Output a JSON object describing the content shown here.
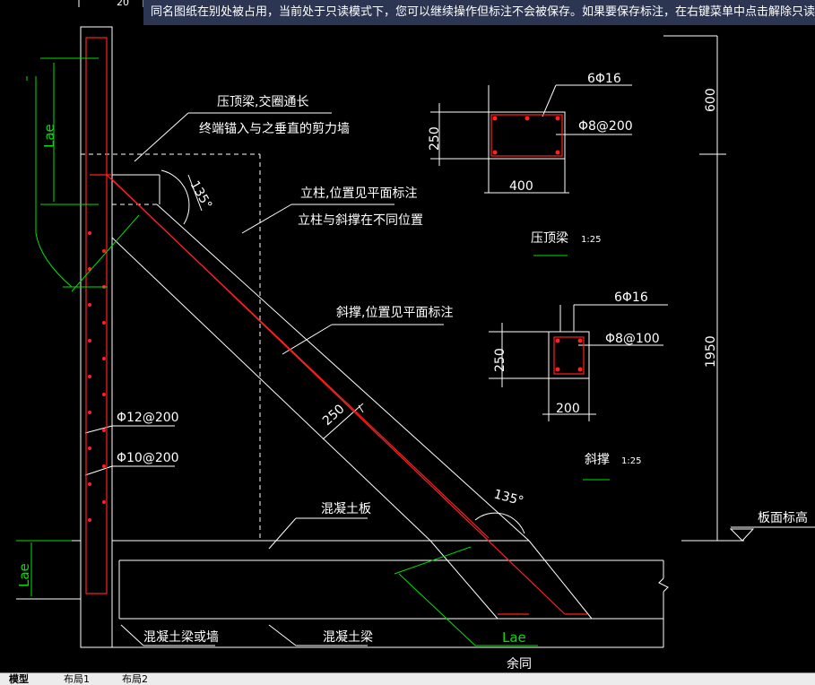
{
  "notice": "同名图纸在别处被占用，当前处于只读模式下，您可以继续操作但标注不会被保存。如果要保存标注，在右键菜单中点击解除只读锁",
  "labels": {
    "lae_top": "Lae",
    "lae_bottom": "Lae",
    "lae_right": "Lae",
    "note_beam_1": "压顶梁,交圈通长",
    "note_beam_2": "终端锚入与之垂直的剪力墙",
    "note_column_1": "立柱,位置见平面标注",
    "note_column_2": "立柱与斜撑在不同位置",
    "note_brace": "斜撑,位置见平面标注",
    "angle_top": "135°",
    "angle_bottom": "135°",
    "brace_width": "250",
    "rebar_1": "Φ12@200",
    "rebar_2": "Φ10@200",
    "slab": "混凝土板",
    "beam_wall": "混凝土梁或墙",
    "beam": "混凝土梁",
    "same": "余同",
    "slab_level": "板面标高",
    "dim_600": "600",
    "dim_1950": "1950",
    "top_dim_partial": "20"
  },
  "section1": {
    "top_rebar": "6Φ16",
    "stirrup": "Φ8@200",
    "height": "250",
    "width": "400",
    "title": "压顶梁",
    "scale": "1:25"
  },
  "section2": {
    "top_rebar": "6Φ16",
    "stirrup": "Φ8@100",
    "height": "250",
    "width": "200",
    "title": "斜撑",
    "scale": "1:25"
  },
  "tabs": [
    "模型",
    "布局1",
    "布局2"
  ],
  "colors": {
    "line": "#ffffff",
    "rebar": "#ff2020",
    "dimension": "#00e000",
    "background": "#000000",
    "notice_bg": "#2c3652"
  }
}
